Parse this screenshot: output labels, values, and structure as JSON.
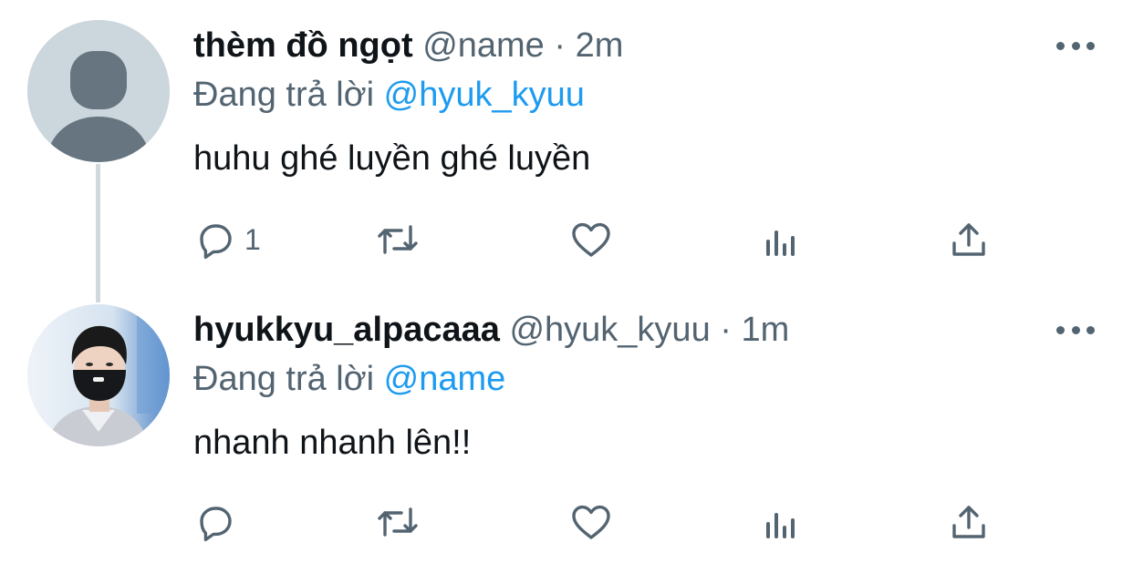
{
  "tweets": [
    {
      "author_name": "thèm đồ ngọt",
      "handle": "@name",
      "separator": "·",
      "time": "2m",
      "replying_prefix": "Đang trả lời",
      "replying_to": "@hyuk_kyuu",
      "text": "huhu ghé luyền ghé luyền",
      "reply_count": "1",
      "avatar": "default-profile-silhouette"
    },
    {
      "author_name": "hyukkyu_alpacaaa",
      "handle": "@hyuk_kyuu",
      "separator": "·",
      "time": "1m",
      "replying_prefix": "Đang trả lời",
      "replying_to": "@name",
      "text": "nhanh nhanh lên!!",
      "reply_count": "",
      "avatar": "person-with-black-mask-photo"
    }
  ],
  "icons": {
    "reply": "reply-icon",
    "retweet": "retweet-icon",
    "like": "heart-icon",
    "stats": "analytics-icon",
    "share": "share-icon",
    "more": "more-icon"
  },
  "colors": {
    "text": "#0f1419",
    "secondary": "#536471",
    "link": "#1d9bf0",
    "thread_line": "#cfd9de"
  }
}
